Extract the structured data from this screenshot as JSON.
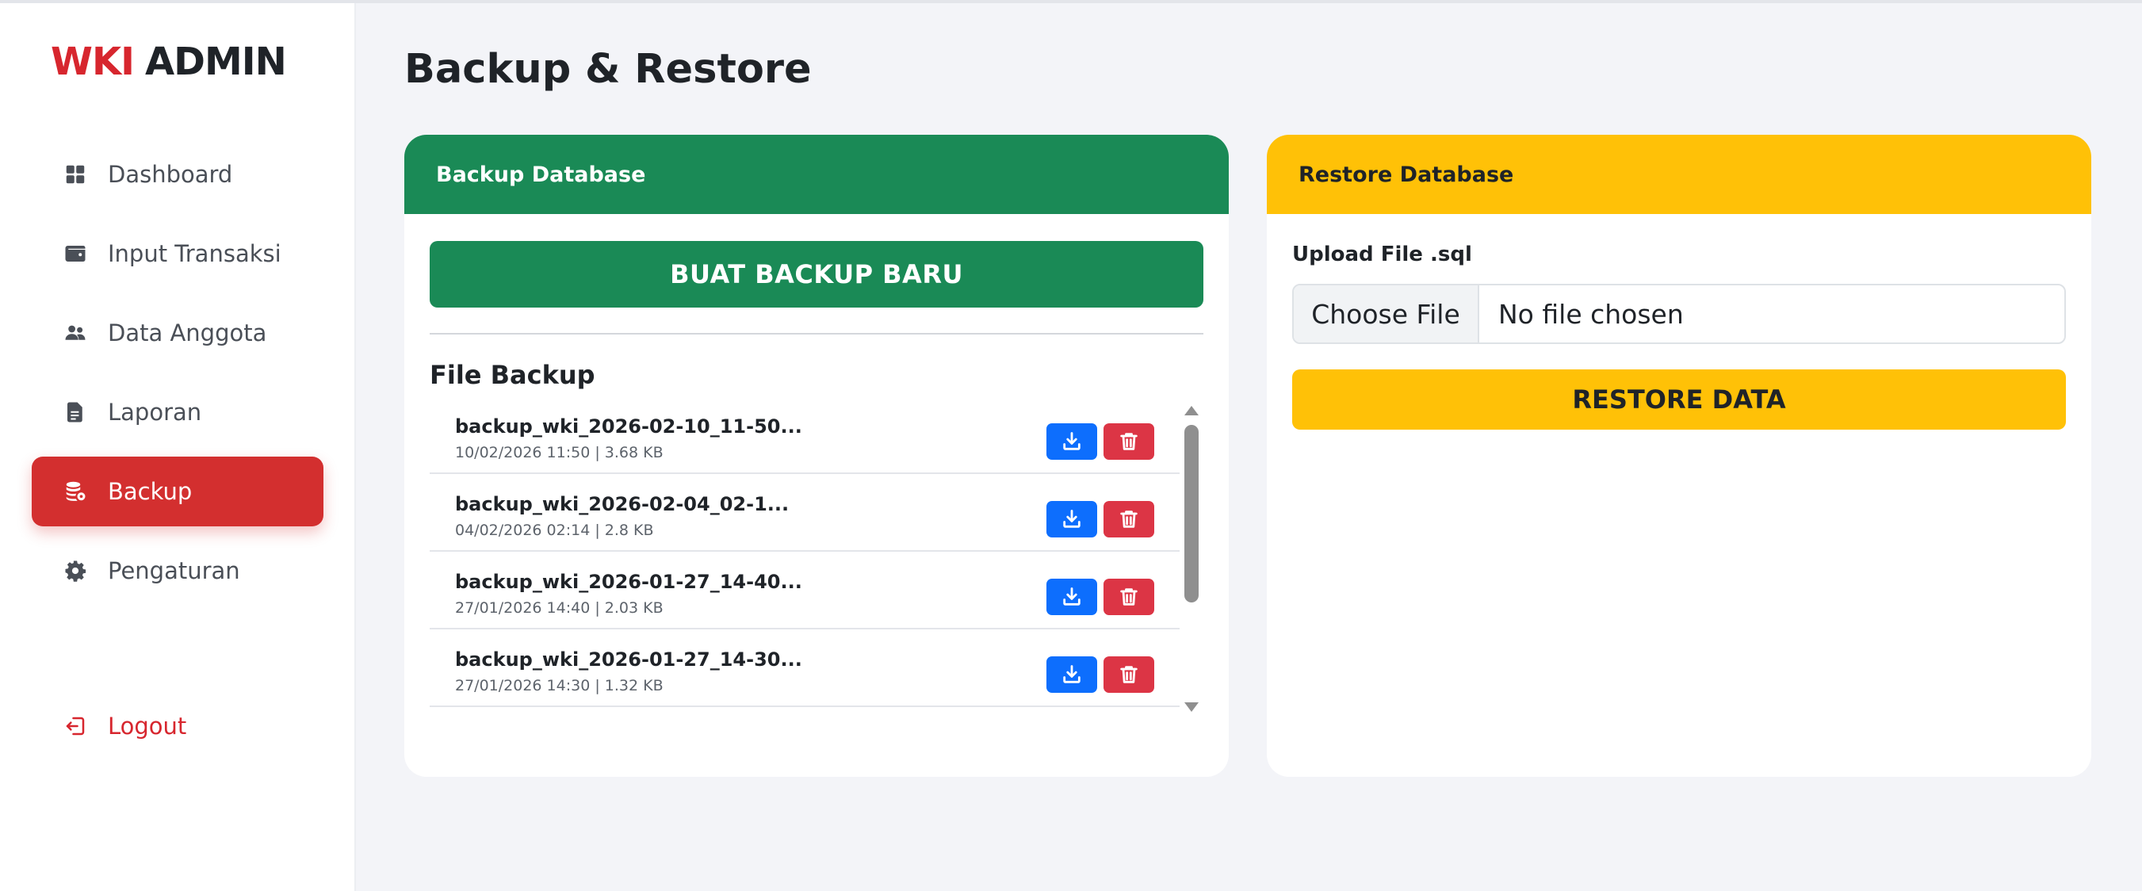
{
  "brand": {
    "part1": "WKI",
    "part2": "ADMIN"
  },
  "sidebar": {
    "items": [
      {
        "label": "Dashboard",
        "icon": "grid-icon"
      },
      {
        "label": "Input Transaksi",
        "icon": "wallet-icon"
      },
      {
        "label": "Data Anggota",
        "icon": "users-icon"
      },
      {
        "label": "Laporan",
        "icon": "file-icon"
      },
      {
        "label": "Backup",
        "icon": "database-icon",
        "active": true
      },
      {
        "label": "Pengaturan",
        "icon": "gear-icon"
      }
    ],
    "logout": {
      "label": "Logout",
      "icon": "logout-icon"
    }
  },
  "page": {
    "title": "Backup & Restore"
  },
  "backup_card": {
    "header": "Backup Database",
    "create_button": "BUAT BACKUP BARU",
    "list_title": "File Backup",
    "files": [
      {
        "name": "backup_wki_2026-02-10_11-50...",
        "meta": "10/02/2026 11:50 | 3.68 KB"
      },
      {
        "name": "backup_wki_2026-02-04_02-1...",
        "meta": "04/02/2026 02:14 | 2.8 KB"
      },
      {
        "name": "backup_wki_2026-01-27_14-40...",
        "meta": "27/01/2026 14:40 | 2.03 KB"
      },
      {
        "name": "backup_wki_2026-01-27_14-30...",
        "meta": "27/01/2026 14:30 | 1.32 KB"
      }
    ]
  },
  "restore_card": {
    "header": "Restore Database",
    "upload_label": "Upload File .sql",
    "choose_button": "Choose File",
    "file_status": "No file chosen",
    "restore_button": "RESTORE DATA"
  },
  "colors": {
    "brand_red": "#d7262e",
    "active_nav": "#d32f2f",
    "backup_green": "#1a8a56",
    "restore_yellow": "#ffc107",
    "download_blue": "#0d6efd",
    "delete_red": "#dc3545"
  }
}
